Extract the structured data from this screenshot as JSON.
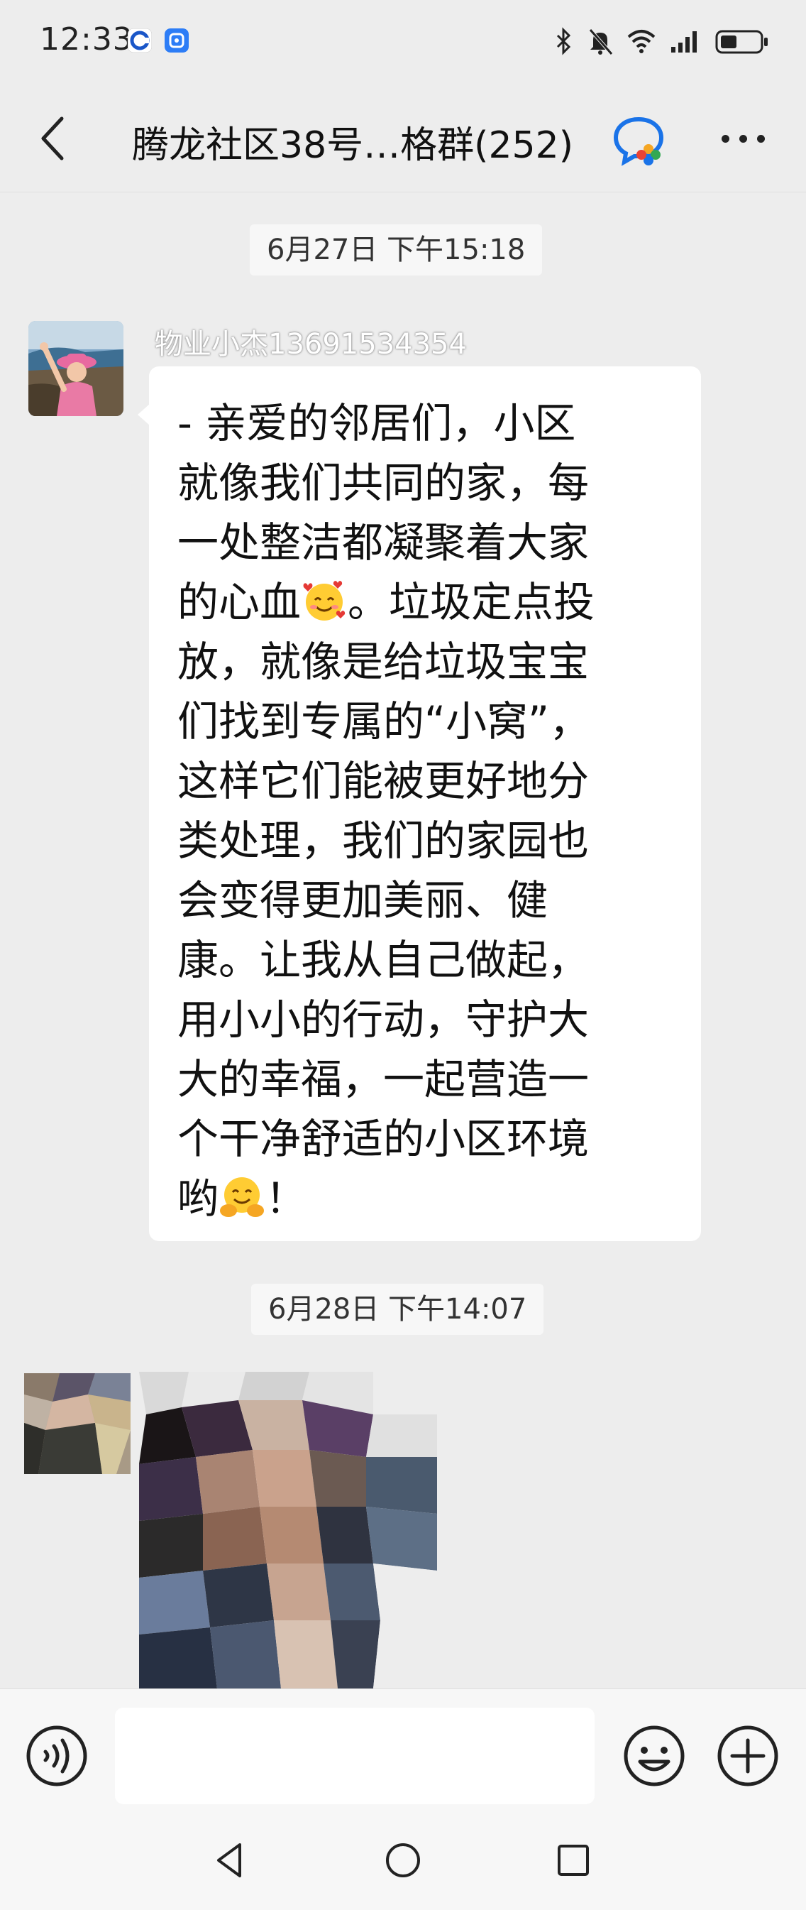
{
  "status_bar": {
    "time": "12:33",
    "icons": [
      "bluetooth-icon",
      "mute-icon",
      "wifi-icon",
      "signal-icon",
      "battery-icon"
    ]
  },
  "header": {
    "title": "腾龙社区38号…格群(252)",
    "more_icon": "more-dots-icon"
  },
  "messages": [
    {
      "timestamp": "6月27日 下午15:18",
      "sender": "物业小杰13691534354",
      "lines": [
        "- 亲爱的邻居们，小区",
        "就像我们共同的家，每",
        "一处整洁都凝聚着大家",
        "的心血",
        "。垃圾定点投",
        "放，就像是给垃圾宝宝",
        "们找到专属的“小窝”，",
        "这样它们能被更好地分",
        "类处理，我们的家园也",
        "会变得更加美丽、健",
        "康。让我从自己做起，",
        "用小小的行动，守护大",
        "大的幸福，一起营造一",
        "个干净舒适的小区环境",
        "哟",
        "！"
      ]
    },
    {
      "timestamp": "6月28日 下午14:07",
      "type": "image"
    }
  ],
  "input_bar": {
    "placeholder": "",
    "value": ""
  },
  "colors": {
    "background": "#ededed",
    "bubble": "#ffffff",
    "accent_blue": "#1a73e8"
  }
}
